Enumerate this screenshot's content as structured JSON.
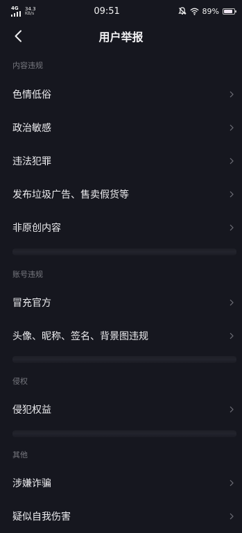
{
  "status": {
    "network": "4G",
    "speed_value": "34.3",
    "speed_unit": "KB/s",
    "time": "09:51",
    "battery": "89%",
    "battery_level": 0.89
  },
  "nav": {
    "title": "用户举报"
  },
  "sections": [
    {
      "label": "内容违规",
      "items": [
        "色情低俗",
        "政治敏感",
        "违法犯罪",
        "发布垃圾广告、售卖假货等",
        "非原创内容"
      ]
    },
    {
      "label": "账号违规",
      "items": [
        "冒充官方",
        "头像、昵称、签名、背景图违规"
      ]
    },
    {
      "label": "侵权",
      "items": [
        "侵犯权益"
      ]
    },
    {
      "label": "其他",
      "items": [
        "涉嫌诈骗",
        "疑似自我伤害"
      ]
    }
  ]
}
